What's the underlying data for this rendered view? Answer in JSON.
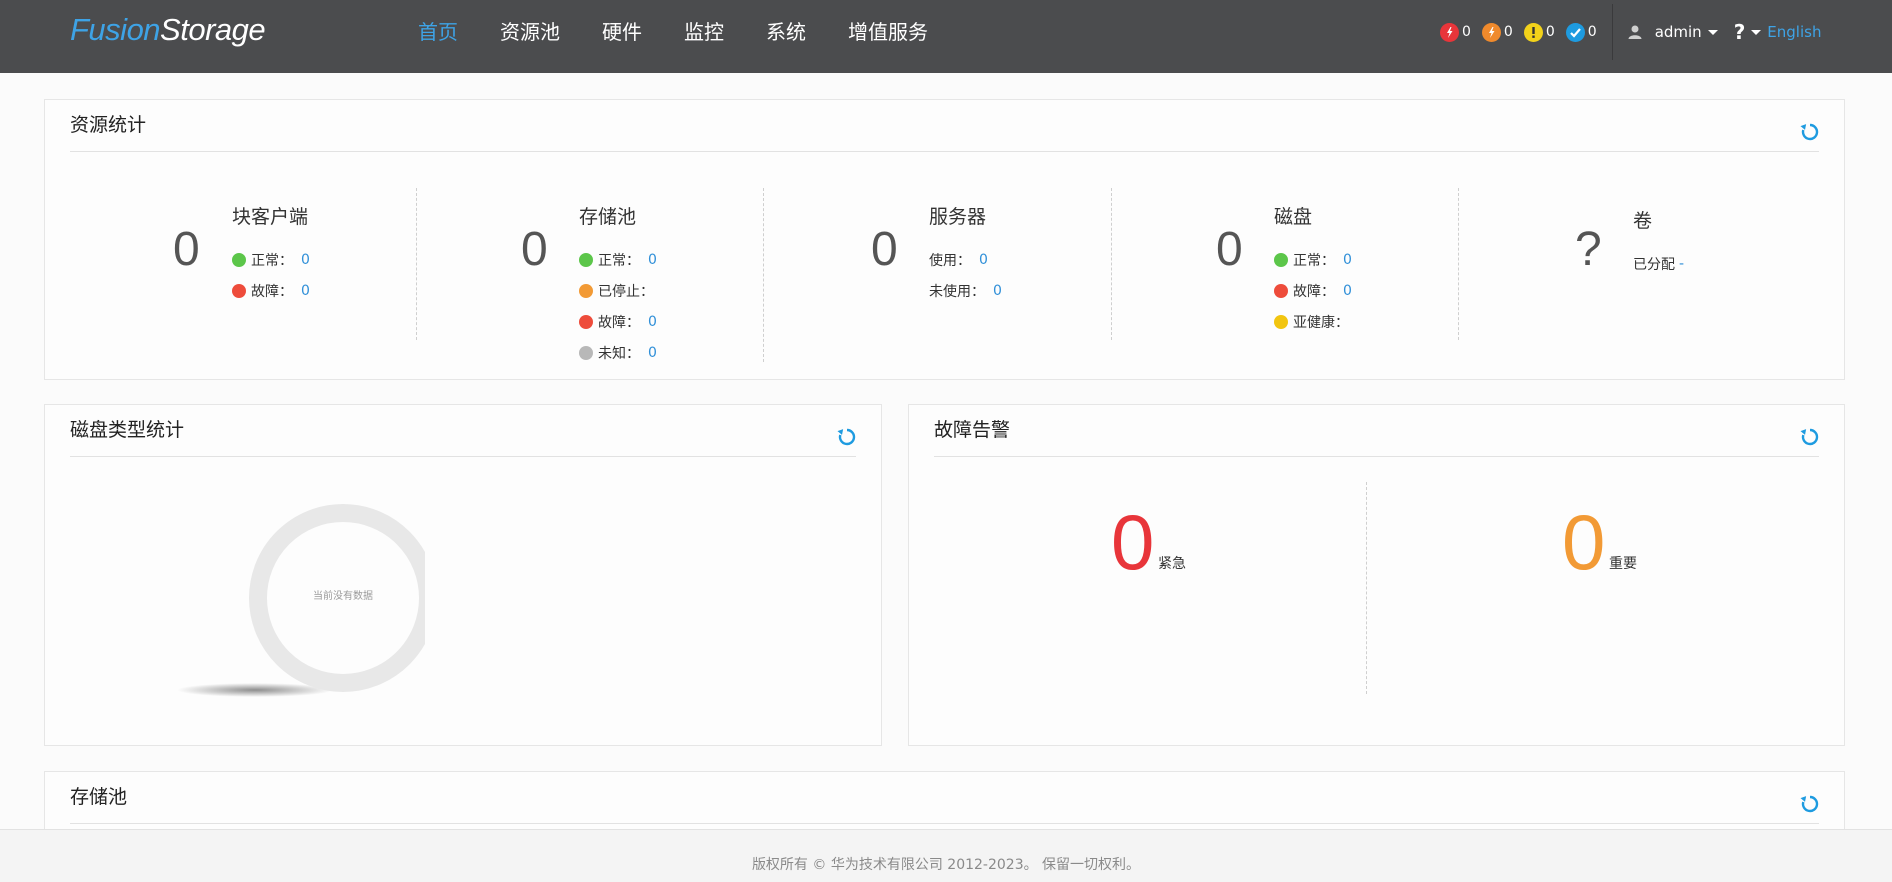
{
  "brand": {
    "part1": "Fusion",
    "part2": "Storage"
  },
  "nav": [
    {
      "label": "首页",
      "active": true
    },
    {
      "label": "资源池",
      "active": false
    },
    {
      "label": "硬件",
      "active": false
    },
    {
      "label": "监控",
      "active": false
    },
    {
      "label": "系统",
      "active": false
    },
    {
      "label": "增值服务",
      "active": false
    }
  ],
  "header_alarms": [
    {
      "icon": "critical-alarm-icon",
      "color": "#e8353a",
      "count": "0"
    },
    {
      "icon": "major-alarm-icon",
      "color": "#f08a2c",
      "count": "0"
    },
    {
      "icon": "minor-alarm-icon",
      "color": "#f2d21a",
      "count": "0"
    },
    {
      "icon": "cleared-alarm-icon",
      "color": "#1e9be0",
      "count": "0"
    }
  ],
  "user": {
    "name": "admin",
    "help": "?",
    "language": "English"
  },
  "resource_stats": {
    "title": "资源统计",
    "block_client": {
      "count": "0",
      "title": "块客户端",
      "normal_label": "正常：",
      "normal_value": "0",
      "fault_label": "故障：",
      "fault_value": "0"
    },
    "storage_pool": {
      "count": "0",
      "title": "存储池",
      "normal_label": "正常：",
      "normal_value": "0",
      "stopped_label": "已停止：",
      "fault_label": "故障：",
      "fault_value": "0",
      "unknown_label": "未知：",
      "unknown_value": "0"
    },
    "server": {
      "count": "0",
      "title": "服务器",
      "used_label": "使用：",
      "used_value": "0",
      "unused_label": "未使用：",
      "unused_value": "0"
    },
    "disk": {
      "count": "0",
      "title": "磁盘",
      "normal_label": "正常：",
      "normal_value": "0",
      "fault_label": "故障：",
      "fault_value": "0",
      "subhealth_label": "亚健康："
    },
    "volume": {
      "count": "?",
      "title": "卷",
      "allocated_label": "已分配",
      "allocated_value": "-"
    }
  },
  "disk_type_stats": {
    "title": "磁盘类型统计",
    "empty_text": "当前没有数据"
  },
  "fault_alarm": {
    "title": "故障告警",
    "critical": {
      "value": "0",
      "label": "紧急",
      "color": "#e8353a"
    },
    "major": {
      "value": "0",
      "label": "重要",
      "color": "#f29a35"
    }
  },
  "storage_pool_panel": {
    "title": "存储池"
  },
  "footer": {
    "copyright": "版权所有 © 华为技术有限公司 2012-2023。 保留一切权利。"
  },
  "colors": {
    "header_bg": "#4b4c4e",
    "accent": "#3ea3e6"
  }
}
